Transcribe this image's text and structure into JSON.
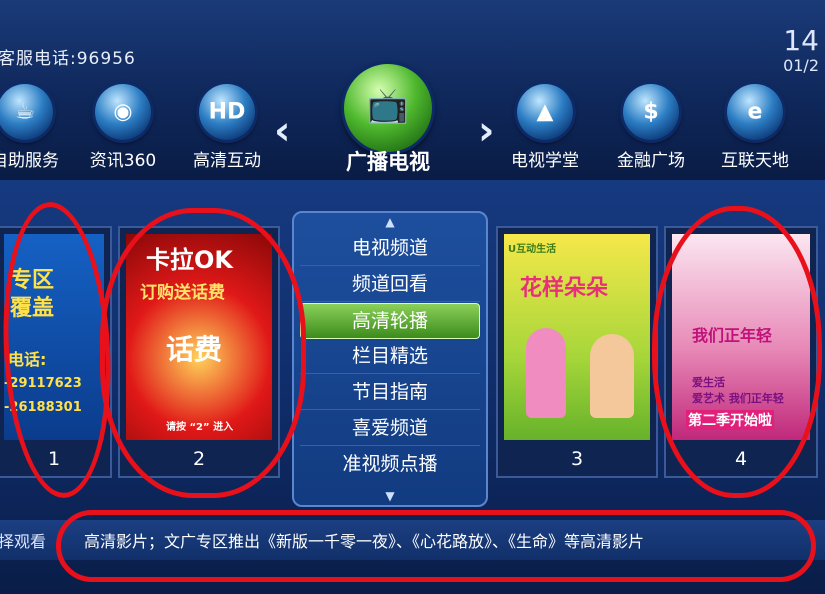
{
  "header": {
    "phone": "客服电话:96956",
    "time": "14",
    "date": "01/2"
  },
  "nav": {
    "items": [
      {
        "label": "自助服务",
        "icon": "coffee-cup-icon",
        "glyph": "☕"
      },
      {
        "label": "资讯360",
        "icon": "globe-icon",
        "glyph": "◉"
      },
      {
        "label": "高清互动",
        "icon": "hd-icon",
        "glyph": "HD"
      },
      {
        "label": "电视学堂",
        "icon": "graduation-cap-icon",
        "glyph": "▲"
      },
      {
        "label": "金融广场",
        "icon": "money-bag-icon",
        "glyph": "$"
      },
      {
        "label": "互联天地",
        "icon": "internet-explorer-icon",
        "glyph": "e"
      }
    ],
    "current": {
      "label": "广播电视",
      "icon": "tv-icon",
      "glyph": "📺"
    },
    "prev_arrow": "‹",
    "next_arrow": "›"
  },
  "cards": [
    {
      "number": "1",
      "lines": [
        "专区",
        "覆盖",
        "电话:",
        "-29117623",
        "-26188301"
      ]
    },
    {
      "number": "2",
      "lines": [
        "卡拉OK",
        "订购送话费",
        "话费",
        "请按 “2” 进入"
      ]
    },
    {
      "number": "3",
      "lines": [
        "花样朵朵",
        "U互动生活"
      ]
    },
    {
      "number": "4",
      "lines": [
        "我们正年轻",
        "爱生活",
        "爱艺术 我们正年轻",
        "第二季开始啦"
      ]
    }
  ],
  "menu": {
    "up": "▲",
    "down": "▼",
    "items": [
      "电视频道",
      "频道回看",
      "高清轮播",
      "栏目精选",
      "节目指南",
      "喜爱频道",
      "准视频点播"
    ],
    "selected_index": 2
  },
  "ticker": {
    "left": "择观看",
    "message": "高清影片；文广专区推出《新版一千零一夜》、《心花路放》、《生命》等高清影片"
  },
  "colors": {
    "menu_selected": "#5aa52a",
    "annotation_red": "#e8101a"
  }
}
